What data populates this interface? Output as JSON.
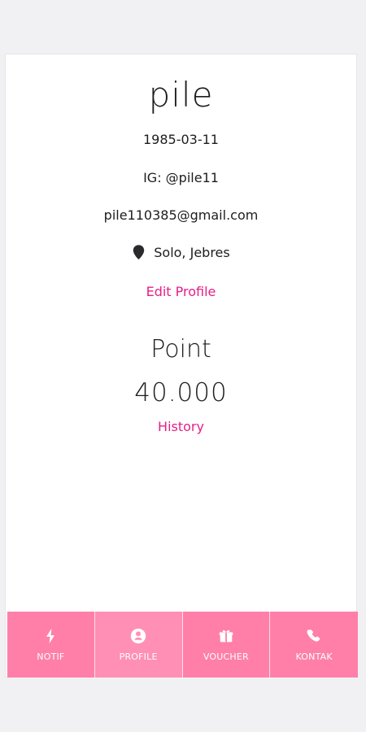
{
  "theme": {
    "accent": "#e61f86",
    "tabbar_bg": "#ff7fa8",
    "tabbar_active_bg": "#ff8fb4",
    "text": "#1d1d1f",
    "background": "#f1f1f3"
  },
  "profile": {
    "name": "pile",
    "dob": "1985-03-11",
    "instagram": "IG: @pile11",
    "email": "pile110385@gmail.com",
    "location": "Solo, Jebres",
    "location_icon": "map-pin-icon",
    "edit_label": "Edit Profile"
  },
  "points": {
    "label": "Point",
    "value": "40.000",
    "history_label": "History"
  },
  "tabs": [
    {
      "label": "NOTIF",
      "icon": "bolt-icon"
    },
    {
      "label": "PROFILE",
      "icon": "user-circle-icon",
      "active": true
    },
    {
      "label": "VOUCHER",
      "icon": "gift-icon"
    },
    {
      "label": "KONTAK",
      "icon": "phone-icon"
    }
  ]
}
